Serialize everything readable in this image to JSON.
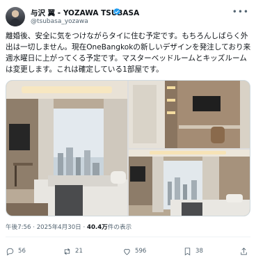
{
  "author": {
    "name": "与沢 翼 - YOZAWA TSUBASA",
    "handle": "@tsubasa_yozawa",
    "verified": true
  },
  "tweet": {
    "lines": [
      "離婚後、安全に気をつけながらタイに住む予定です。もちろんしばらく外",
      "出は一切しません。現在OneBangkokの新しいデザインを発注しており来",
      "週水曜日に上がってくる予定です。マスターベッドルームとキッズルーム",
      "は変更します。これは確定している1部屋です。"
    ]
  },
  "meta": {
    "time": "午後7:56",
    "date": "2025年4月30日",
    "views_count": "40.4万",
    "views_label": "件の表示",
    "separator": "·"
  },
  "actions": {
    "replies": "56",
    "reposts": "21",
    "likes": "596",
    "bookmarks": "38"
  },
  "icons": [
    "verified-badge-icon",
    "more-icon",
    "reply-icon",
    "repost-icon",
    "like-icon",
    "bookmark-icon",
    "share-icon"
  ],
  "colors": {
    "verified": "#1d9bf0",
    "text": "#0f1419",
    "secondary": "#536471"
  }
}
